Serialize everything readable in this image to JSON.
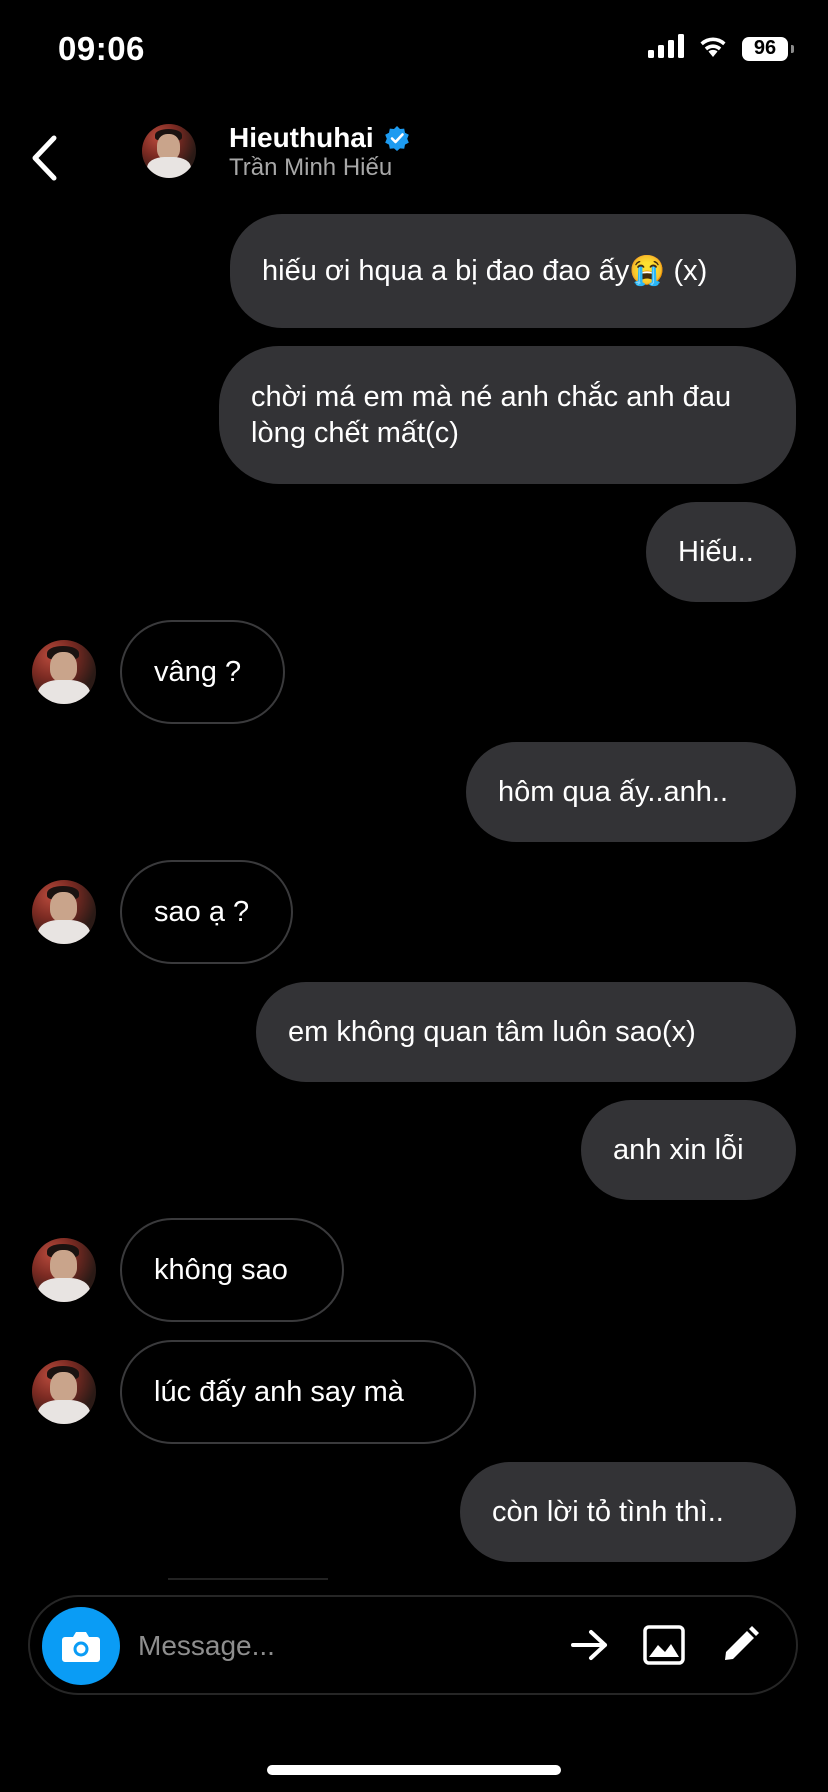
{
  "status_bar": {
    "time": "09:06",
    "battery": "96",
    "icons": [
      "signal-icon",
      "wifi-icon",
      "battery-icon"
    ]
  },
  "header": {
    "name": "Hieuthuhai",
    "verified": true,
    "subtitle": "Trần Minh Hiếu",
    "icons": [
      "back-arrow-icon",
      "verified-badge-icon"
    ]
  },
  "messages": [
    {
      "from": "me",
      "text": "hiếu ơi hqua a bị đao đao ấy😭 (x)"
    },
    {
      "from": "me",
      "text": "chời má em mà né anh chắc anh đau lòng chết mất(c)"
    },
    {
      "from": "me",
      "text": "Hiếu.."
    },
    {
      "from": "them",
      "text": "vâng ?"
    },
    {
      "from": "me",
      "text": "hôm qua ấy..anh.."
    },
    {
      "from": "them",
      "text": "sao ạ ?"
    },
    {
      "from": "me",
      "text": "em không quan tâm luôn sao(x)"
    },
    {
      "from": "me",
      "text": "anh xin lỗi"
    },
    {
      "from": "them",
      "text": "không sao"
    },
    {
      "from": "them",
      "text": "lúc đấy anh say mà"
    },
    {
      "from": "me",
      "text": "còn lời tỏ tình thì.."
    }
  ],
  "composer": {
    "placeholder": "Message...",
    "icons": [
      "camera-icon",
      "send-arrow-icon",
      "gallery-icon",
      "pencil-icon"
    ]
  },
  "colors": {
    "background": "#000000",
    "outgoing_bubble": "#333336",
    "incoming_border": "#3a3a3c",
    "camera_button": "#0a9cf5",
    "verified_badge": "#1d9bf0",
    "subtitle_text": "#a8a8a8"
  }
}
